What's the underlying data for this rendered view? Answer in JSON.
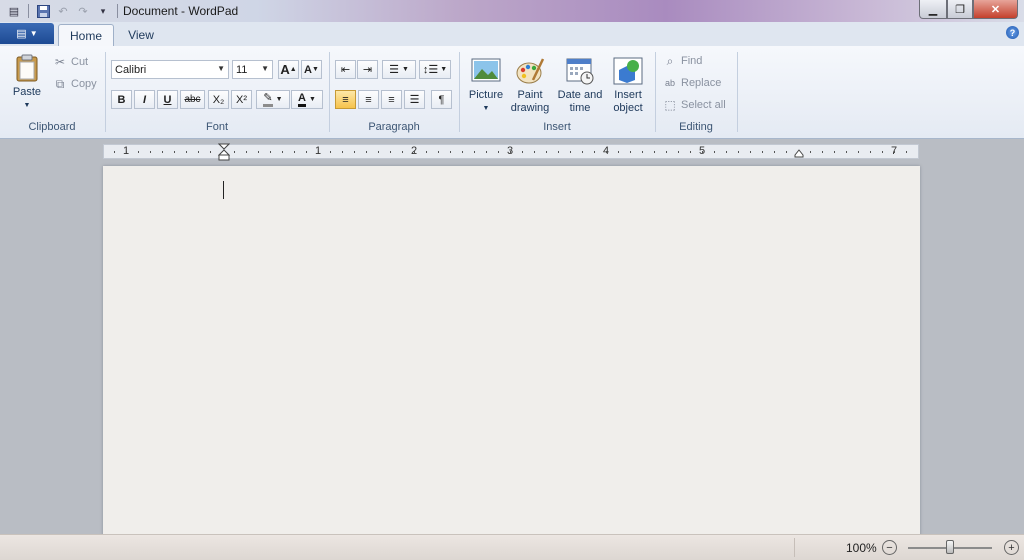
{
  "window": {
    "title": "Document - WordPad"
  },
  "tabs": [
    {
      "label": "Home"
    },
    {
      "label": "View"
    }
  ],
  "help_glyph": "?",
  "clipboard": {
    "paste": "Paste",
    "cut": "Cut",
    "copy": "Copy",
    "label": "Clipboard"
  },
  "font": {
    "name": "Calibri",
    "size": "11",
    "label": "Font",
    "bold": "B",
    "italic": "I",
    "underline": "U",
    "strike": "abc",
    "subscript": "X₂",
    "superscript": "X²",
    "grow": "A",
    "shrink": "A"
  },
  "paragraph": {
    "label": "Paragraph"
  },
  "insert": {
    "picture": "Picture",
    "paint_drawing": "Paint drawing",
    "date_time": "Date and time",
    "insert_object": "Insert object",
    "label": "Insert"
  },
  "editing": {
    "find": "Find",
    "replace": "Replace",
    "select_all": "Select all",
    "label": "Editing"
  },
  "ruler": {
    "marks": [
      "1",
      "1",
      "2",
      "3",
      "4",
      "5",
      "7"
    ]
  },
  "status": {
    "zoom": "100%",
    "zoom_level": 0.5
  },
  "colors": {
    "app_button": "#1d4a93",
    "highlight_active": "#f6c34c",
    "page": "#f0eeeb"
  }
}
